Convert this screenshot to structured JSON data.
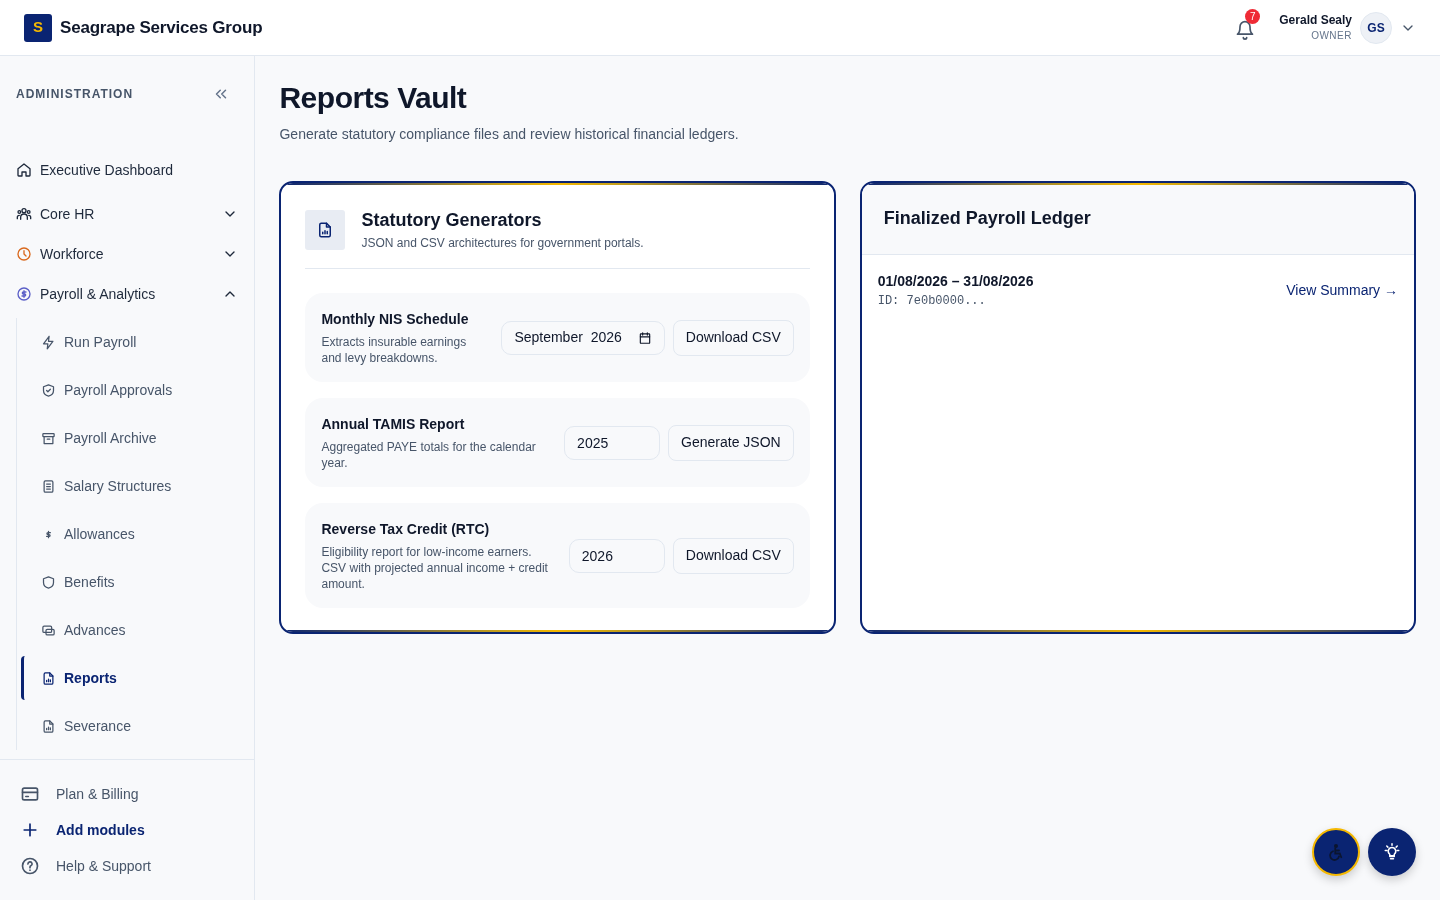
{
  "brand": {
    "logo_letter": "S",
    "name": "Seagrape Services Group"
  },
  "header": {
    "notification_count": "7",
    "user_name": "Gerald Sealy",
    "user_role": "OWNER",
    "avatar_initials": "GS"
  },
  "sidebar": {
    "section_title": "ADMINISTRATION",
    "items": [
      {
        "label": "Executive Dashboard"
      },
      {
        "label": "Core HR",
        "expandable": true,
        "expanded": false
      },
      {
        "label": "Workforce",
        "expandable": true,
        "expanded": false
      },
      {
        "label": "Payroll & Analytics",
        "expandable": true,
        "expanded": true,
        "children": [
          {
            "label": "Run Payroll",
            "selected": false
          },
          {
            "label": "Payroll Approvals",
            "selected": false
          },
          {
            "label": "Payroll Archive",
            "selected": false
          },
          {
            "label": "Salary Structures",
            "selected": false
          },
          {
            "label": "Allowances",
            "selected": false
          },
          {
            "label": "Benefits",
            "selected": false
          },
          {
            "label": "Advances",
            "selected": false
          },
          {
            "label": "Reports",
            "selected": true
          },
          {
            "label": "Severance",
            "selected": false
          }
        ]
      }
    ],
    "footer": [
      {
        "label": "Plan & Billing",
        "kind": "plain"
      },
      {
        "label": "Add modules",
        "kind": "accent"
      },
      {
        "label": "Help & Support",
        "kind": "plain"
      }
    ]
  },
  "page": {
    "title": "Reports Vault",
    "subtitle": "Generate statutory compliance files and review historical financial ledgers."
  },
  "generators": {
    "title": "Statutory Generators",
    "subtitle": "JSON and CSV architectures for government portals.",
    "reports": [
      {
        "title": "Monthly NIS Schedule",
        "description": "Extracts insurable earnings and levy breakdowns.",
        "kind": "month",
        "value": "September  2026",
        "action": "Download CSV"
      },
      {
        "title": "Annual TAMIS Report",
        "description": "Aggregated PAYE totals for the calendar year.",
        "kind": "year",
        "value": "2025",
        "action": "Generate JSON"
      },
      {
        "title": "Reverse Tax Credit (RTC)",
        "description": "Eligibility report for low-income earners. CSV with projected annual income + credit amount.",
        "kind": "year",
        "value": "2026",
        "action": "Download CSV"
      }
    ]
  },
  "ledger": {
    "title": "Finalized Payroll Ledger",
    "entries": [
      {
        "period": "01/08/2026 – 31/08/2026",
        "id": "ID: 7e0b0000...",
        "link": "View Summary →"
      }
    ]
  }
}
